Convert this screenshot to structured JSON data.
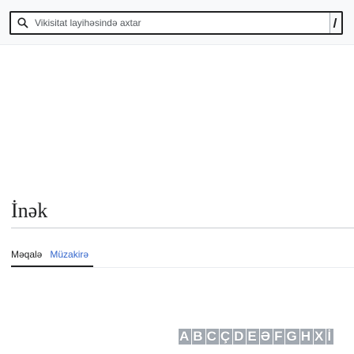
{
  "search": {
    "placeholder": "Vikisitat layihəsində axtar"
  },
  "page": {
    "title": "İnək"
  },
  "tabs": [
    {
      "label": "Məqalə",
      "selected": true
    },
    {
      "label": "Müzakirə",
      "selected": false
    }
  ],
  "alphabet": [
    "A",
    "B",
    "C",
    "Ç",
    "D",
    "E",
    "Ə",
    "F",
    "G",
    "H",
    "X",
    "İ"
  ],
  "colors": {
    "link": "#3366cc",
    "text": "#202122",
    "border": "#a2a9b1"
  },
  "icons": [
    "search-icon"
  ]
}
